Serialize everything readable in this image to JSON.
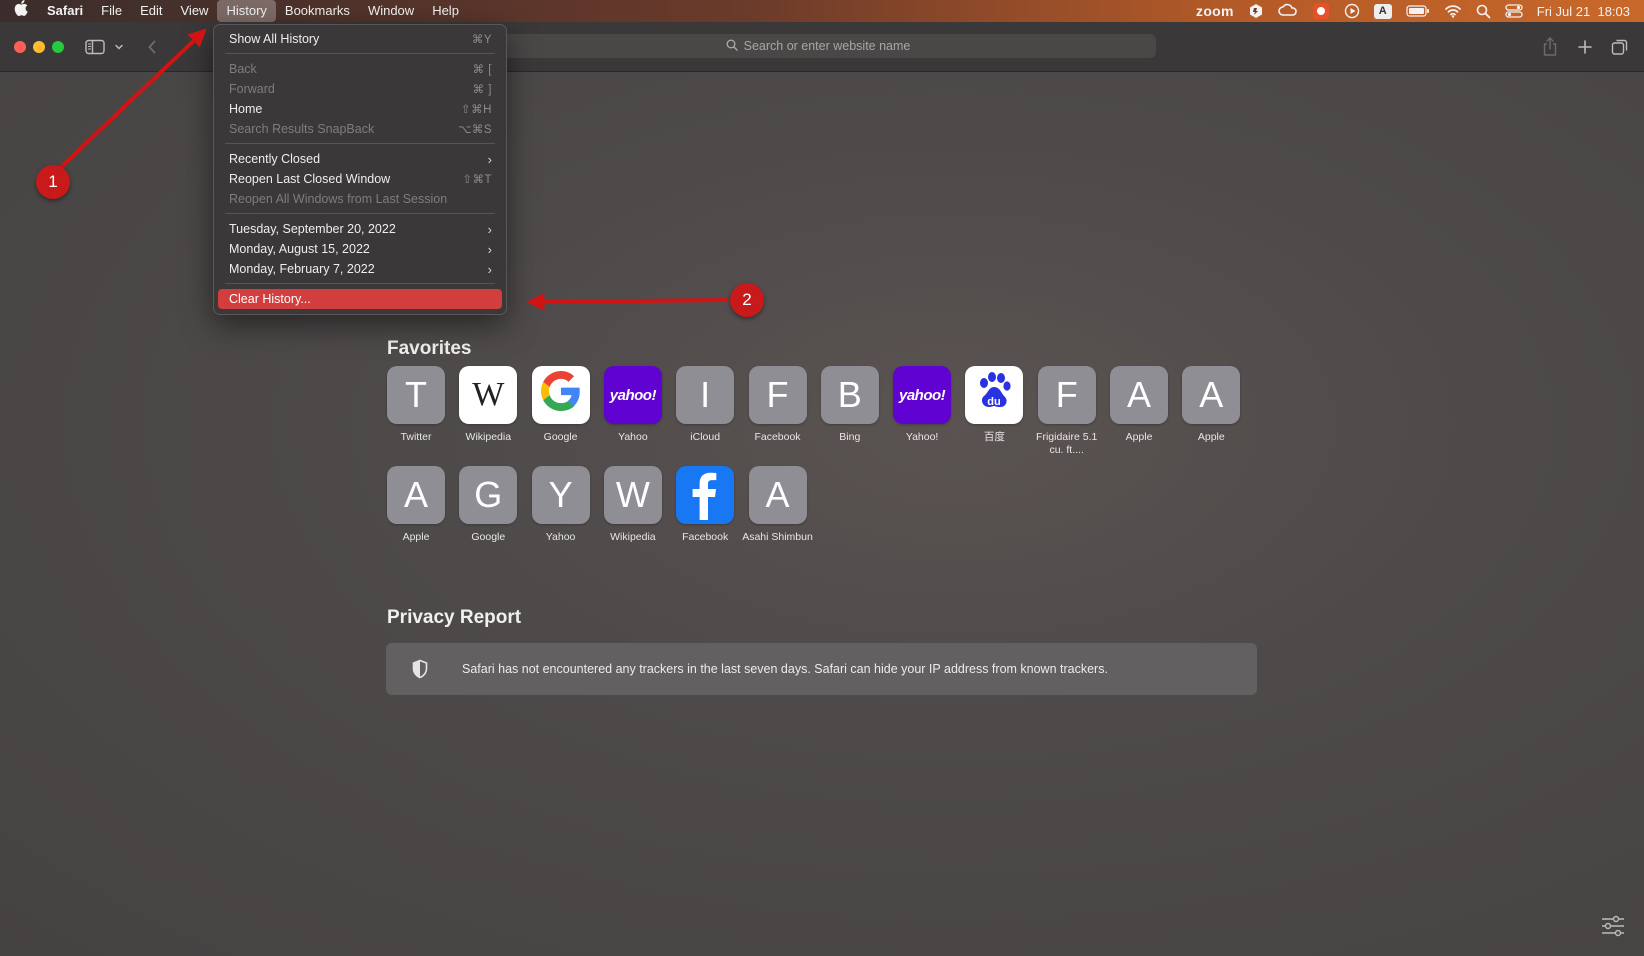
{
  "menubar": {
    "app": "Safari",
    "items": [
      "File",
      "Edit",
      "View",
      "History",
      "Bookmarks",
      "Window",
      "Help"
    ],
    "status": {
      "zoom": "zoom",
      "input_source": "A",
      "datetime": "Fri Jul 21  18:03"
    }
  },
  "toolbar": {
    "address_placeholder": "Search or enter website name"
  },
  "history_menu": {
    "show_all": {
      "label": "Show All History",
      "shortcut": "⌘Y"
    },
    "back": {
      "label": "Back",
      "shortcut": "⌘ ["
    },
    "forward": {
      "label": "Forward",
      "shortcut": "⌘ ]"
    },
    "home": {
      "label": "Home",
      "shortcut": "⇧⌘H"
    },
    "snapback": {
      "label": "Search Results SnapBack",
      "shortcut": "⌥⌘S"
    },
    "recently_closed": {
      "label": "Recently Closed"
    },
    "reopen_last": {
      "label": "Reopen Last Closed Window",
      "shortcut": "⇧⌘T"
    },
    "reopen_all": {
      "label": "Reopen All Windows from Last Session"
    },
    "dates": [
      "Tuesday, September 20, 2022",
      "Monday, August 15, 2022",
      "Monday, February 7, 2022"
    ],
    "clear": {
      "label": "Clear History..."
    }
  },
  "favorites": {
    "title": "Favorites",
    "row1": [
      {
        "letter": "T",
        "label": "Twitter"
      },
      {
        "letter": "W",
        "label": "Wikipedia"
      },
      {
        "letter": "",
        "label": "Google"
      },
      {
        "letter": "yahoo!",
        "label": "Yahoo"
      },
      {
        "letter": "I",
        "label": "iCloud"
      },
      {
        "letter": "F",
        "label": "Facebook"
      },
      {
        "letter": "B",
        "label": "Bing"
      },
      {
        "letter": "yahoo!",
        "label": "Yahoo!"
      },
      {
        "letter": "du",
        "label": "百度"
      },
      {
        "letter": "F",
        "label": "Frigidaire 5.1 cu. ft...."
      },
      {
        "letter": "A",
        "label": "Apple"
      },
      {
        "letter": "A",
        "label": "Apple"
      }
    ],
    "row2": [
      {
        "letter": "A",
        "label": "Apple"
      },
      {
        "letter": "G",
        "label": "Google"
      },
      {
        "letter": "Y",
        "label": "Yahoo"
      },
      {
        "letter": "W",
        "label": "Wikipedia"
      },
      {
        "letter": "f",
        "label": "Facebook"
      },
      {
        "letter": "A",
        "label": "Asahi Shimbun"
      }
    ]
  },
  "privacy": {
    "title": "Privacy Report",
    "text": "Safari has not encountered any trackers in the last seven days. Safari can hide your IP address from known trackers."
  },
  "annotations": {
    "step1": "1",
    "step2": "2",
    "color": "#d01414"
  }
}
